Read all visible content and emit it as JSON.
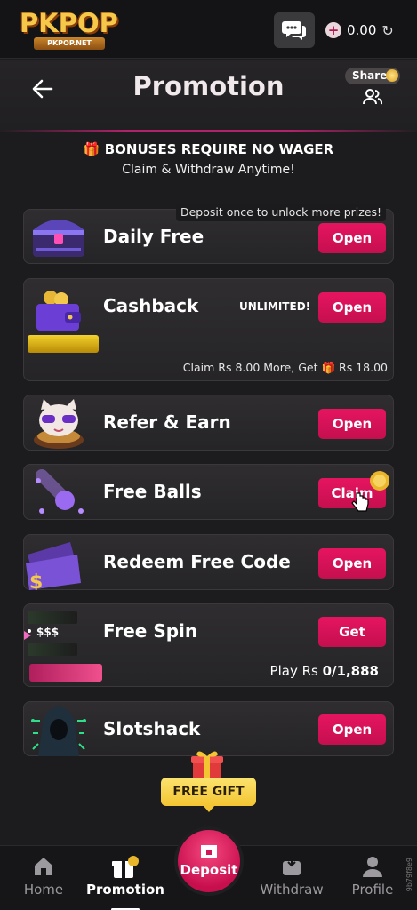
{
  "topbar": {
    "logo_text": "PKPOP",
    "logo_sub": "PKPOP.NET",
    "balance": "0.00"
  },
  "header": {
    "title": "Promotion",
    "share_label": "Share"
  },
  "bonus": {
    "title": "BONUSES REQUIRE NO WAGER",
    "subtitle": "Claim & Withdraw Anytime!"
  },
  "cards": {
    "daily_free": {
      "tip": "Deposit once to unlock more prizes!",
      "label": "Daily Free",
      "button": "Open"
    },
    "cashback": {
      "label": "Cashback",
      "badge": "UNLIMITED!",
      "button": "Open",
      "info_prefix": "Claim Rs 8.00 More, Get",
      "info_suffix": "Rs 18.00",
      "progress": 0.0
    },
    "refer": {
      "label": "Refer & Earn",
      "button": "Open"
    },
    "free_balls": {
      "label": "Free Balls",
      "button": "Claim"
    },
    "redeem": {
      "label": "Redeem Free Code",
      "button": "Open"
    },
    "free_spin": {
      "label": "Free Spin",
      "button": "Get",
      "art_text": "$$$",
      "play_prefix": "Play Rs",
      "play_value": "0/1,888"
    },
    "slotshack": {
      "label": "Slotshack",
      "button": "Open"
    }
  },
  "free_gift": "FREE GIFT",
  "nav": {
    "home": "Home",
    "promotion": "Promotion",
    "deposit": "Deposit",
    "withdraw": "Withdraw",
    "profile": "Profile"
  },
  "side_text": "9b79f8e9",
  "colors": {
    "accent": "#d9125a",
    "background": "#1c1b1d",
    "gold": "#f3c532"
  }
}
